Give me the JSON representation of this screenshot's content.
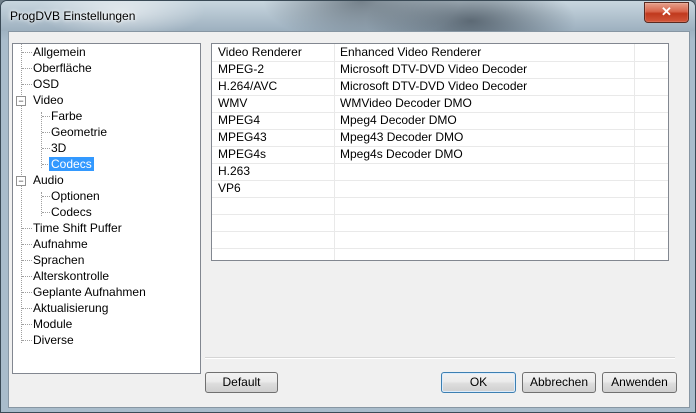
{
  "window": {
    "title": "ProgDVB Einstellungen",
    "close_glyph": "✕"
  },
  "tree": {
    "items": [
      {
        "label": "Allgemein"
      },
      {
        "label": "Oberfläche"
      },
      {
        "label": "OSD"
      },
      {
        "label": "Video",
        "expanded": true
      },
      {
        "label": "Farbe"
      },
      {
        "label": "Geometrie"
      },
      {
        "label": "3D"
      },
      {
        "label": "Codecs",
        "selected": true
      },
      {
        "label": "Audio",
        "expanded": true
      },
      {
        "label": "Optionen"
      },
      {
        "label": "Codecs"
      },
      {
        "label": "Time Shift Puffer"
      },
      {
        "label": "Aufnahme"
      },
      {
        "label": "Sprachen"
      },
      {
        "label": "Alterskontrolle"
      },
      {
        "label": "Geplante Aufnahmen"
      },
      {
        "label": "Aktualisierung"
      },
      {
        "label": "Module"
      },
      {
        "label": "Diverse"
      }
    ],
    "expander_glyph": "−"
  },
  "codecs": {
    "rows": [
      {
        "format": "Video Renderer",
        "decoder": "Enhanced Video Renderer"
      },
      {
        "format": "MPEG-2",
        "decoder": "Microsoft DTV-DVD Video Decoder"
      },
      {
        "format": "H.264/AVC",
        "decoder": "Microsoft DTV-DVD Video Decoder"
      },
      {
        "format": "WMV",
        "decoder": "WMVideo Decoder DMO"
      },
      {
        "format": "MPEG4",
        "decoder": "Mpeg4 Decoder DMO"
      },
      {
        "format": "MPEG43",
        "decoder": "Mpeg43 Decoder DMO"
      },
      {
        "format": "MPEG4s",
        "decoder": "Mpeg4s Decoder DMO"
      },
      {
        "format": "H.263",
        "decoder": ""
      },
      {
        "format": "VP6",
        "decoder": ""
      }
    ]
  },
  "buttons": {
    "default": "Default",
    "ok": "OK",
    "cancel": "Abbrechen",
    "apply": "Anwenden"
  }
}
